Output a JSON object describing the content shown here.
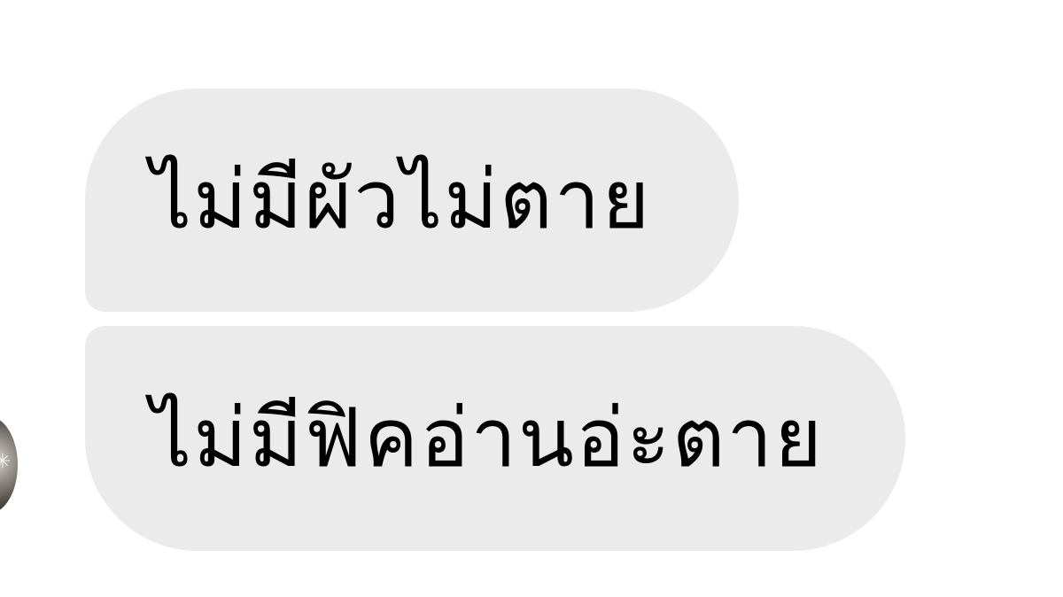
{
  "messages": [
    {
      "text": "ไม่มีผัวไม่ตาย"
    },
    {
      "text": "ไม่มีฟิคอ่านอ่ะตาย"
    }
  ],
  "colors": {
    "bubble_background": "#ebebeb",
    "text": "#000000",
    "page_background": "#ffffff"
  },
  "icons": {
    "avatar": "user-avatar"
  }
}
